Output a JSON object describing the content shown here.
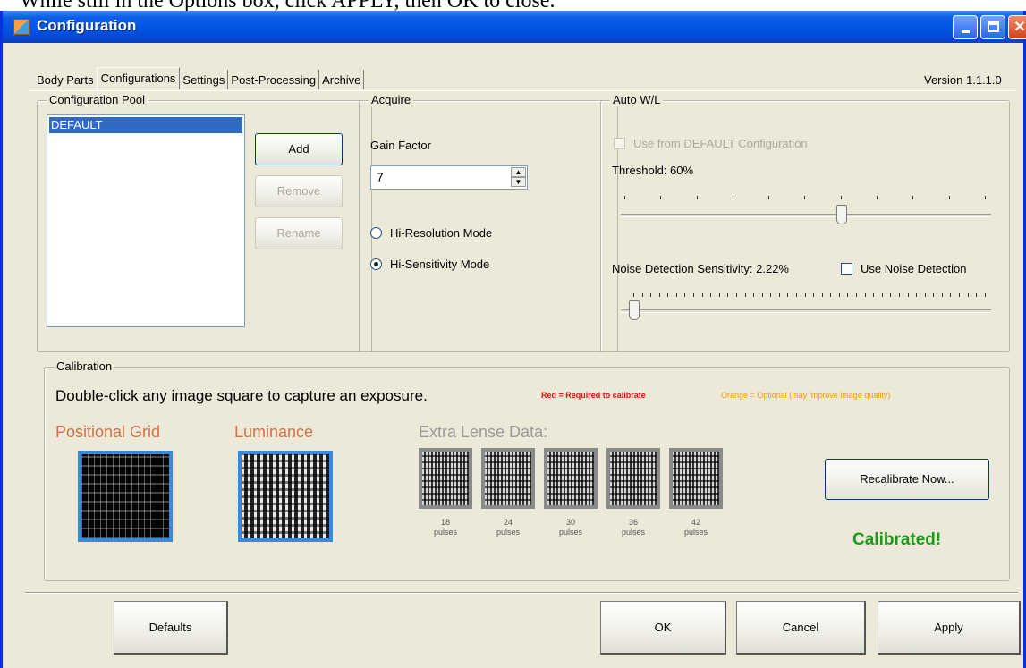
{
  "caption": "While still in the Options box, click APPLY, then OK to close.",
  "window": {
    "title": "Configuration"
  },
  "tabs": [
    "Body Parts",
    "Configurations",
    "Settings",
    "Post-Processing",
    "Archive"
  ],
  "active_tab": "Configurations",
  "version": "Version 1.1.1.0",
  "pool": {
    "label": "Configuration Pool",
    "items": [
      "DEFAULT"
    ],
    "add": "Add",
    "remove": "Remove",
    "rename": "Rename"
  },
  "acquire": {
    "label": "Acquire",
    "gain_label": "Gain Factor",
    "gain_value": "7",
    "mode_hires": "Hi-Resolution Mode",
    "mode_hisens": "Hi-Sensitivity Mode",
    "selected_mode": "Hi-Sensitivity Mode"
  },
  "auto_wl": {
    "label": "Auto W/L",
    "use_default": "Use from DEFAULT Configuration",
    "threshold_label": "Threshold: 60%",
    "threshold_percent": 60,
    "noise_label": "Noise Detection Sensitivity: 2.22%",
    "noise_percent": 2.22,
    "use_noise": "Use Noise Detection"
  },
  "calibration": {
    "label": "Calibration",
    "instruction": "Double-click any image square to capture an exposure.",
    "legend_red": "Red = Required to calibrate",
    "legend_orange": "Orange = Optional (may improve image quality)",
    "positional_grid": "Positional Grid",
    "luminance": "Luminance",
    "extra": "Extra Lense Data:",
    "pulses": [
      {
        "n": "18",
        "unit": "pulses"
      },
      {
        "n": "24",
        "unit": "pulses"
      },
      {
        "n": "30",
        "unit": "pulses"
      },
      {
        "n": "36",
        "unit": "pulses"
      },
      {
        "n": "42",
        "unit": "pulses"
      }
    ],
    "recalibrate": "Recalibrate Now...",
    "status": "Calibrated!"
  },
  "buttons": {
    "defaults": "Defaults",
    "ok": "OK",
    "cancel": "Cancel",
    "apply": "Apply"
  },
  "colors": {
    "required": "#e01010",
    "optional": "#f59a00",
    "calibrated": "#1a9a1a",
    "selected_border": "#3a8ad8"
  }
}
